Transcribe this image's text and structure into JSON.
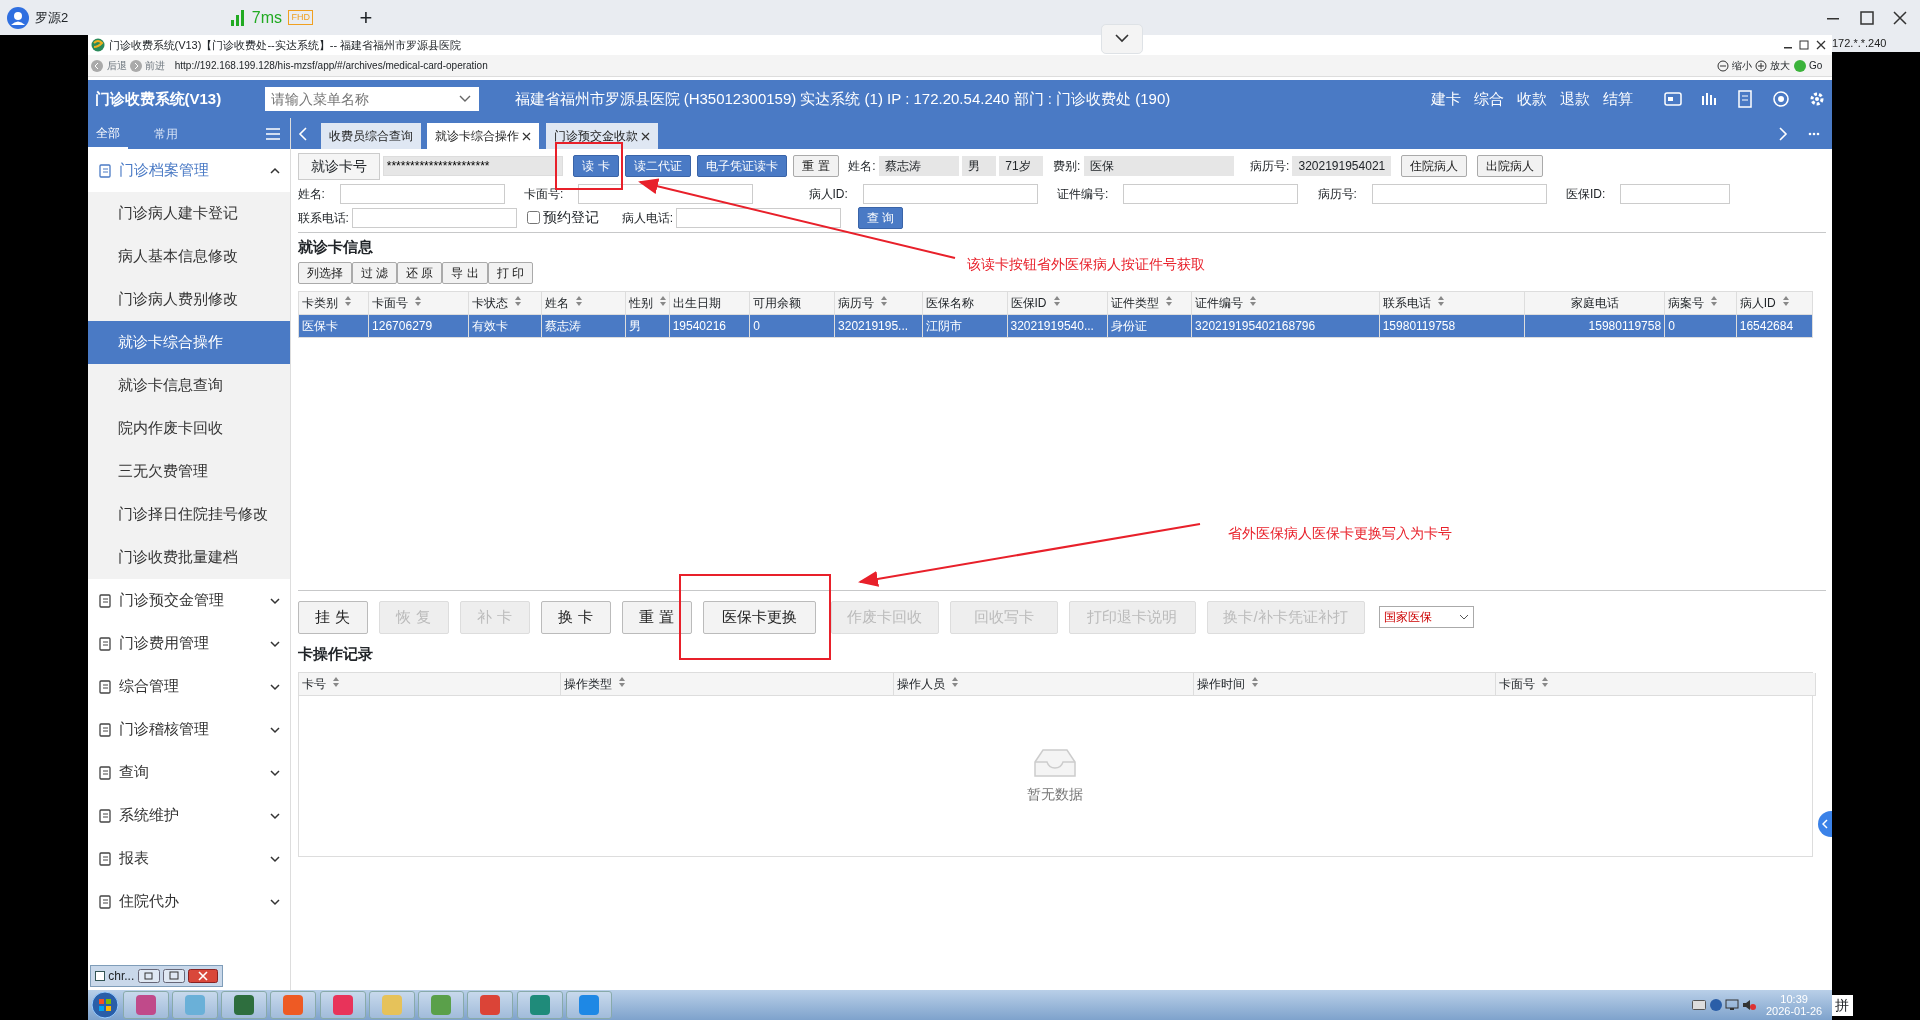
{
  "browser_tab": {
    "title": "罗源2",
    "ping": "7ms",
    "quality": "FHD",
    "new_tab": "+"
  },
  "remote_ip": "172.*.*.240",
  "window": {
    "title": "门诊收费系统(V13)【门诊收费处--实达系统】-- 福建省福州市罗源县医院",
    "back": "后退",
    "forward": "前进",
    "address": "http://192.168.199.128/his-mzsf/app/#/archives/medical-card-operation",
    "zoom_out": "缩小",
    "zoom_in": "放大",
    "go": "Go"
  },
  "app_header": {
    "title": "门诊收费系统(V13)",
    "menu_search_placeholder": "请输入菜单名称",
    "info": "福建省福州市罗源县医院 (H35012300159) 实达系统 (1) IP : 172.20.54.240 部门 : 门诊收费处 (190)",
    "actions": [
      "建卡",
      "综合",
      "收款",
      "退款",
      "结算"
    ]
  },
  "sidebar": {
    "tabs": [
      {
        "label": "全部",
        "selected": true
      },
      {
        "label": "常用",
        "selected": false
      }
    ],
    "groups": [
      {
        "label": "门诊档案管理",
        "expanded": true,
        "children": [
          {
            "label": "门诊病人建卡登记",
            "selected": false
          },
          {
            "label": "病人基本信息修改",
            "selected": false
          },
          {
            "label": "门诊病人费别修改",
            "selected": false
          },
          {
            "label": "就诊卡综合操作",
            "selected": true
          },
          {
            "label": "就诊卡信息查询",
            "selected": false
          },
          {
            "label": "院内作废卡回收",
            "selected": false
          },
          {
            "label": "三无欠费管理",
            "selected": false
          },
          {
            "label": "门诊择日住院挂号修改",
            "selected": false
          },
          {
            "label": "门诊收费批量建档",
            "selected": false
          }
        ]
      },
      {
        "label": "门诊预交金管理",
        "expanded": false
      },
      {
        "label": "门诊费用管理",
        "expanded": false
      },
      {
        "label": "综合管理",
        "expanded": false
      },
      {
        "label": "门诊稽核管理",
        "expanded": false
      },
      {
        "label": "查询",
        "expanded": false
      },
      {
        "label": "系统维护",
        "expanded": false
      },
      {
        "label": "报表",
        "expanded": false
      },
      {
        "label": "住院代办",
        "expanded": false
      }
    ]
  },
  "page_tabs": [
    {
      "label": "收费员综合查询",
      "selected": false,
      "closable": false
    },
    {
      "label": "就诊卡综合操作",
      "selected": true,
      "closable": true
    },
    {
      "label": "门诊预交金收款",
      "selected": false,
      "closable": true
    }
  ],
  "card_bar": {
    "label": "就诊卡号",
    "card_number": "**********************",
    "buttons": [
      {
        "label": "读 卡",
        "kind": "primary"
      },
      {
        "label": "读二代证",
        "kind": "primary"
      },
      {
        "label": "电子凭证读卡",
        "kind": "primary"
      },
      {
        "label": "重 置",
        "kind": "default"
      }
    ],
    "patient": {
      "name_label": "姓名:",
      "name": "蔡志涛",
      "gender": "男",
      "age": "71岁",
      "fee_label": "费别:",
      "fee_type": "医保",
      "record_label": "病历号:",
      "record_no": "3202191954021"
    },
    "patient_buttons": [
      "住院病人",
      "出院病人"
    ]
  },
  "search_form": {
    "row_1": [
      {
        "label": "姓名:"
      },
      {
        "label": "卡面号:"
      },
      {
        "label": "病人ID:"
      },
      {
        "label": "证件编号:"
      },
      {
        "label": "病历号:"
      },
      {
        "label": "医保ID:"
      }
    ],
    "phone_label": "联系电话:",
    "appointment": {
      "label": "预约登记",
      "checked": false
    },
    "patient_phone_label": "病人电话:",
    "query_button": "查 询"
  },
  "card_info": {
    "title": "就诊卡信息",
    "toolbar": [
      "列选择",
      "过 滤",
      "还 原",
      "导 出",
      "打 印"
    ],
    "columns": [
      {
        "label": "卡类别",
        "sortable": true
      },
      {
        "label": "卡面号",
        "sortable": true
      },
      {
        "label": "卡状态",
        "sortable": true
      },
      {
        "label": "姓名",
        "sortable": true
      },
      {
        "label": "性别",
        "sortable": true
      },
      {
        "label": "出生日期",
        "sortable": false
      },
      {
        "label": "可用余额",
        "sortable": false
      },
      {
        "label": "病历号",
        "sortable": true
      },
      {
        "label": "医保名称",
        "sortable": false
      },
      {
        "label": "医保ID",
        "sortable": true
      },
      {
        "label": "证件类型",
        "sortable": true
      },
      {
        "label": "证件编号",
        "sortable": true
      },
      {
        "label": "联系电话",
        "sortable": true
      },
      {
        "label": "家庭电话",
        "sortable": false
      },
      {
        "label": "病案号",
        "sortable": true
      },
      {
        "label": "病人ID",
        "sortable": true
      }
    ],
    "rows": [
      {
        "selected": true,
        "cells": [
          "医保卡",
          "126706279",
          "有效卡",
          "蔡志涛",
          "男",
          "19540216",
          "0",
          "320219195...",
          "江阴市",
          "320219195​40...",
          "身份证",
          "320219195402168796",
          "15980119758",
          "15980119758",
          "0",
          "16542684"
        ]
      }
    ]
  },
  "annotations": [
    "该读卡按钮省外医保病人按证件号获取",
    "省外医保病人医保卡更换写入为卡号"
  ],
  "actions": {
    "buttons": [
      {
        "label": "挂 失",
        "disabled": false
      },
      {
        "label": "恢 复",
        "disabled": true
      },
      {
        "label": "补 卡",
        "disabled": true
      },
      {
        "label": "换 卡",
        "disabled": false
      },
      {
        "label": "重 置",
        "disabled": false
      },
      {
        "label": "医保卡更换",
        "disabled": false
      },
      {
        "label": "作废卡回收",
        "disabled": true
      },
      {
        "label": "回收写卡",
        "disabled": true
      },
      {
        "label": "打印退卡说明",
        "disabled": true
      },
      {
        "label": "换卡/补卡凭证补打",
        "disabled": true
      }
    ],
    "insurance_select": "国家医保"
  },
  "card_log": {
    "title": "卡操作记录",
    "columns": [
      {
        "label": "卡号",
        "sortable": true
      },
      {
        "label": "操作类型",
        "sortable": true
      },
      {
        "label": "操作人员",
        "sortable": true
      },
      {
        "label": "操作时间",
        "sortable": true
      },
      {
        "label": "卡面号",
        "sortable": true
      }
    ],
    "empty_text": "暂无数据"
  },
  "minimized_window": "chr...",
  "taskbar": {
    "time": "10:39",
    "date": "2026-01-26",
    "ime": "拼"
  }
}
